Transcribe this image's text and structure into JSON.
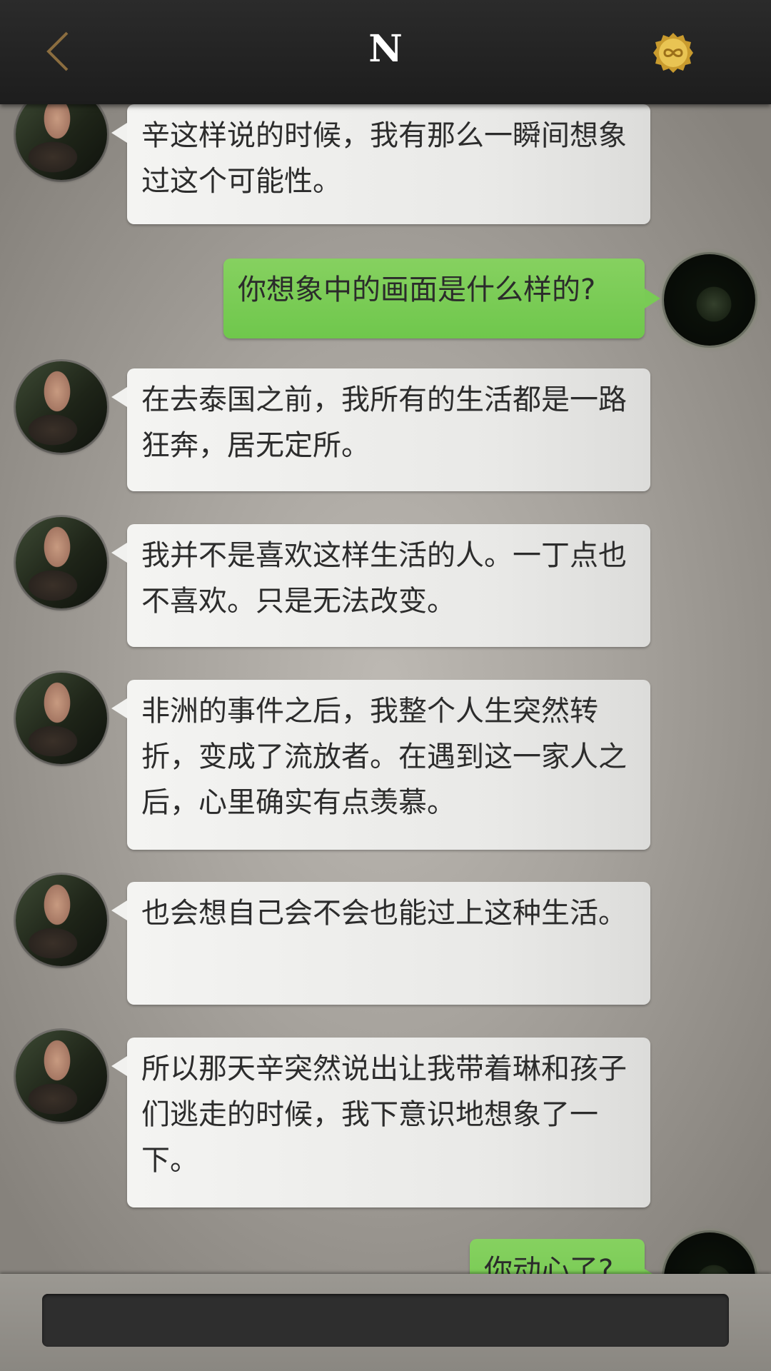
{
  "header": {
    "title": "N",
    "back_icon": "chevron-left-icon",
    "coin_icon": "infinity-coin-icon"
  },
  "colors": {
    "topbar": "#232323",
    "incoming_bubble": "#ececea",
    "outgoing_bubble": "#7acb55",
    "back_icon": "#8b6d3f",
    "coin": "#d8b64a"
  },
  "messages": [
    {
      "side": "in",
      "text": "辛这样说的时候，我有那么一瞬间想象过这个可能性。"
    },
    {
      "side": "out",
      "text": "你想象中的画面是什么样的?"
    },
    {
      "side": "in",
      "text": "在去泰国之前，我所有的生活都是一路狂奔，居无定所。"
    },
    {
      "side": "in",
      "text": "我并不是喜欢这样生活的人。一丁点也不喜欢。只是无法改变。"
    },
    {
      "side": "in",
      "text": "非洲的事件之后，我整个人生突然转折，变成了流放者。在遇到这一家人之后，心里确实有点羡慕。"
    },
    {
      "side": "in",
      "text": "也会想自己会不会也能过上这种生活。"
    },
    {
      "side": "in",
      "text": "所以那天辛突然说出让我带着琳和孩子们逃走的时候，我下意识地想象了一下。"
    },
    {
      "side": "out",
      "text": "你动心了?"
    }
  ],
  "input": {
    "value": ""
  }
}
